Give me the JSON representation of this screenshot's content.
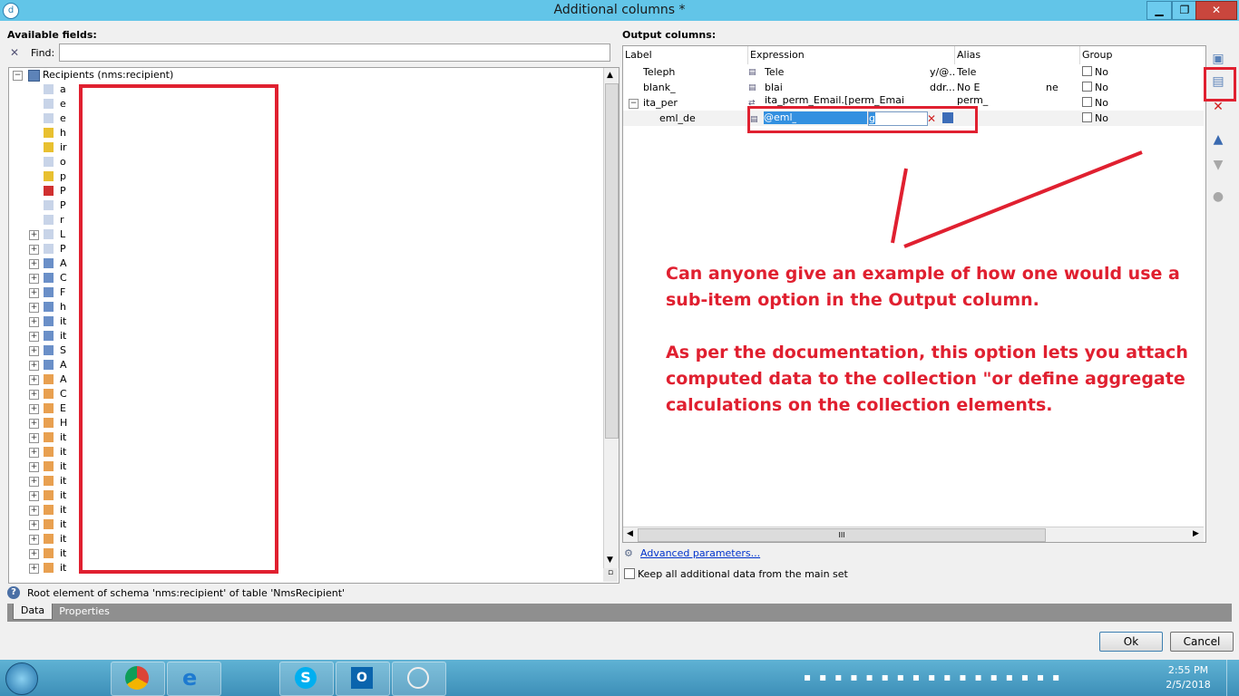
{
  "window": {
    "title": "Additional columns *",
    "minimize": "▁",
    "restore": "❐",
    "close": "✕"
  },
  "left": {
    "title": "Available fields:",
    "find_label": "Find:",
    "find_value": "",
    "root_label": "Recipients (nms:recipient)",
    "rows": [
      "a",
      "e",
      "e",
      "h",
      "ir",
      "o",
      "p",
      "P",
      "P",
      "r",
      "L",
      "P",
      "A",
      "C",
      "F",
      "h",
      "it",
      "it",
      "S",
      "A",
      "A",
      "C",
      "E",
      "H",
      "it",
      "it",
      "it",
      "it",
      "it",
      "it",
      "it",
      "it",
      "it",
      "it"
    ],
    "status": "Root element of schema 'nms:recipient' of table 'NmsRecipient'",
    "tabs": [
      "Data",
      "Properties"
    ]
  },
  "output": {
    "title": "Output columns:",
    "columns": [
      "Label",
      "Expression",
      "Alias",
      "Group"
    ],
    "rows": [
      {
        "label": "Teleph",
        "expr": "Tele",
        "expr2": "y/@..",
        "alias": "Tele",
        "alias2": "",
        "group": "No"
      },
      {
        "label": "blank_",
        "expr": "blai",
        "expr2": "ddr...",
        "alias": "No E",
        "alias2": "ne",
        "group": "No"
      },
      {
        "label": "ita_per",
        "expr": "ita_perm_Email.[perm_Email",
        "expr2": "",
        "alias": "perm_",
        "alias2": "",
        "group": "No"
      },
      {
        "label": "eml_de",
        "expr": "@eml_",
        "expr2": "g",
        "alias": "",
        "alias2": "",
        "group": "No"
      }
    ],
    "scroll_grip": "III",
    "advanced_link": "Advanced parameters...",
    "keep_label": "Keep all additional data from the main set"
  },
  "annotation": {
    "line1": "Can anyone give an example of how one would use a",
    "line2": "sub-item option in the Output column.",
    "line3": "As per the documentation, this option lets you attach",
    "line4": "computed data to the collection \"or define aggregate",
    "line5": "calculations on the collection elements."
  },
  "buttons": {
    "ok": "Ok",
    "cancel": "Cancel"
  },
  "taskbar": {
    "time": "2:55 PM",
    "date": "2/5/2018"
  },
  "colors": {
    "titlebar": "#62c5e8",
    "annotation": "#e02030",
    "taskbar": "#3d8fb8"
  }
}
